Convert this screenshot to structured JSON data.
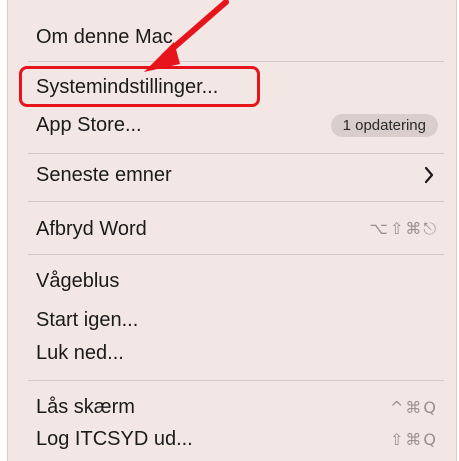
{
  "menu": {
    "items": [
      {
        "label": "Om denne Mac"
      },
      {
        "label": "Systemindstillinger..."
      },
      {
        "label": "App Store...",
        "badge": "1 opdatering"
      },
      {
        "label": "Seneste emner",
        "submenu_icon": "chevron-right-icon"
      },
      {
        "label": "Afbryd Word",
        "shortcut": "⌥⇧⌘⎋"
      },
      {
        "label": "Vågeblus"
      },
      {
        "label": "Start igen..."
      },
      {
        "label": "Luk ned..."
      },
      {
        "label": "Lås skærm",
        "shortcut": "^⌘Q"
      },
      {
        "label": "Log ITCSYD ud...",
        "shortcut": "⇧⌘Q"
      }
    ]
  },
  "annotation": {
    "highlight_color": "#e8141c",
    "arrow_icon": "red-arrow-icon"
  },
  "colors": {
    "menu_background": "#f3e7e5",
    "separator": "#d5c8c6",
    "badge_background": "#d9cecc"
  }
}
